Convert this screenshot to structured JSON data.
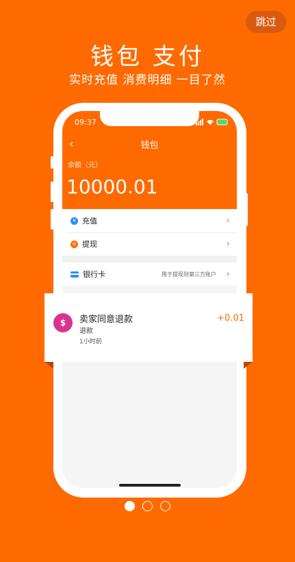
{
  "skip_label": "跳过",
  "hero": {
    "title": "钱包 支付",
    "subtitle": "实时充值 消费明细 一目了然"
  },
  "phone": {
    "status_time": "09:37",
    "nav_title": "钱包",
    "balance_label": "余额（元）",
    "balance_value": "10000.01",
    "menu": [
      {
        "label": "充值",
        "icon": "recharge-icon",
        "color": "#2f8cff"
      },
      {
        "label": "提现",
        "icon": "withdraw-icon",
        "color": "#ff6a00"
      }
    ],
    "bank_card": {
      "label": "银行卡",
      "hint": "用于提现到第三方账户",
      "icon": "card-icon"
    }
  },
  "notification": {
    "title": "卖家同意退款",
    "type": "退款",
    "time": "1小时前",
    "amount": "+0.01",
    "icon": "refund-icon",
    "icon_color": "#d6358f"
  },
  "pagination": {
    "total": 3,
    "active": 1
  },
  "colors": {
    "brand": "#ff6a00",
    "accent": "#ff6a00"
  }
}
